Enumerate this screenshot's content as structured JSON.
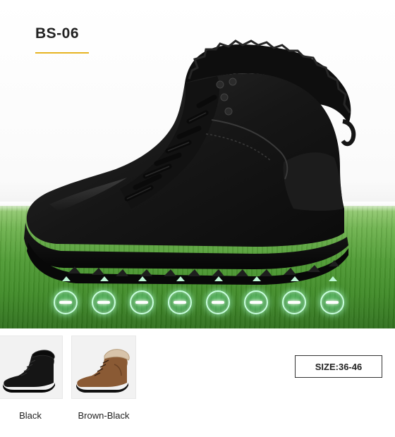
{
  "product": {
    "model_code": "BS-06",
    "accent_color": "#e6b422"
  },
  "sensors": {
    "count": 8,
    "icon": "sensor-circle-icon",
    "color": "#bff7d6"
  },
  "variants": [
    {
      "label": "Black",
      "color": "#151515"
    },
    {
      "label": "Brown-Black",
      "color": "#8a5a34"
    }
  ],
  "size": {
    "label": "SIZE:36-46"
  }
}
